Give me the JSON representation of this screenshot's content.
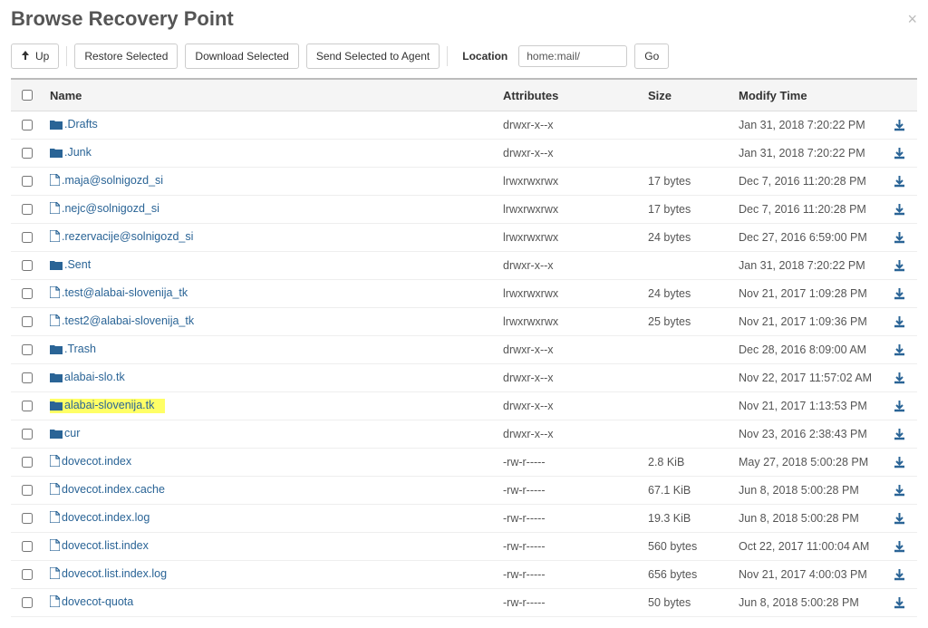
{
  "title": "Browse Recovery Point",
  "toolbar": {
    "up": "Up",
    "restore": "Restore Selected",
    "download": "Download Selected",
    "send": "Send Selected to Agent",
    "location_label": "Location",
    "location_value": "home:mail/",
    "go": "Go"
  },
  "columns": {
    "name": "Name",
    "attributes": "Attributes",
    "size": "Size",
    "modify": "Modify Time"
  },
  "rows": [
    {
      "type": "folder",
      "highlight": false,
      "name": ".Drafts",
      "attr": "drwxr-x--x",
      "size": "",
      "modify": "Jan 31, 2018 7:20:22 PM"
    },
    {
      "type": "folder",
      "highlight": false,
      "name": ".Junk",
      "attr": "drwxr-x--x",
      "size": "",
      "modify": "Jan 31, 2018 7:20:22 PM"
    },
    {
      "type": "file",
      "highlight": false,
      "name": ".maja@solnigozd_si",
      "attr": "lrwxrwxrwx",
      "size": "17 bytes",
      "modify": "Dec 7, 2016 11:20:28 PM"
    },
    {
      "type": "file",
      "highlight": false,
      "name": ".nejc@solnigozd_si",
      "attr": "lrwxrwxrwx",
      "size": "17 bytes",
      "modify": "Dec 7, 2016 11:20:28 PM"
    },
    {
      "type": "file",
      "highlight": false,
      "name": ".rezervacije@solnigozd_si",
      "attr": "lrwxrwxrwx",
      "size": "24 bytes",
      "modify": "Dec 27, 2016 6:59:00 PM"
    },
    {
      "type": "folder",
      "highlight": false,
      "name": ".Sent",
      "attr": "drwxr-x--x",
      "size": "",
      "modify": "Jan 31, 2018 7:20:22 PM"
    },
    {
      "type": "file",
      "highlight": false,
      "name": ".test@alabai-slovenija_tk",
      "attr": "lrwxrwxrwx",
      "size": "24 bytes",
      "modify": "Nov 21, 2017 1:09:28 PM"
    },
    {
      "type": "file",
      "highlight": false,
      "name": ".test2@alabai-slovenija_tk",
      "attr": "lrwxrwxrwx",
      "size": "25 bytes",
      "modify": "Nov 21, 2017 1:09:36 PM"
    },
    {
      "type": "folder",
      "highlight": false,
      "name": ".Trash",
      "attr": "drwxr-x--x",
      "size": "",
      "modify": "Dec 28, 2016 8:09:00 AM"
    },
    {
      "type": "folder",
      "highlight": false,
      "name": "alabai-slo.tk",
      "attr": "drwxr-x--x",
      "size": "",
      "modify": "Nov 22, 2017 11:57:02 AM"
    },
    {
      "type": "folder",
      "highlight": true,
      "name": "alabai-slovenija.tk",
      "attr": "drwxr-x--x",
      "size": "",
      "modify": "Nov 21, 2017 1:13:53 PM"
    },
    {
      "type": "folder",
      "highlight": false,
      "name": "cur",
      "attr": "drwxr-x--x",
      "size": "",
      "modify": "Nov 23, 2016 2:38:43 PM"
    },
    {
      "type": "file",
      "highlight": false,
      "name": "dovecot.index",
      "attr": "-rw-r-----",
      "size": "2.8 KiB",
      "modify": "May 27, 2018 5:00:28 PM"
    },
    {
      "type": "file",
      "highlight": false,
      "name": "dovecot.index.cache",
      "attr": "-rw-r-----",
      "size": "67.1 KiB",
      "modify": "Jun 8, 2018 5:00:28 PM"
    },
    {
      "type": "file",
      "highlight": false,
      "name": "dovecot.index.log",
      "attr": "-rw-r-----",
      "size": "19.3 KiB",
      "modify": "Jun 8, 2018 5:00:28 PM"
    },
    {
      "type": "file",
      "highlight": false,
      "name": "dovecot.list.index",
      "attr": "-rw-r-----",
      "size": "560 bytes",
      "modify": "Oct 22, 2017 11:00:04 AM"
    },
    {
      "type": "file",
      "highlight": false,
      "name": "dovecot.list.index.log",
      "attr": "-rw-r-----",
      "size": "656 bytes",
      "modify": "Nov 21, 2017 4:00:03 PM"
    },
    {
      "type": "file",
      "highlight": false,
      "name": "dovecot-quota",
      "attr": "-rw-r-----",
      "size": "50 bytes",
      "modify": "Jun 8, 2018 5:00:28 PM"
    }
  ]
}
